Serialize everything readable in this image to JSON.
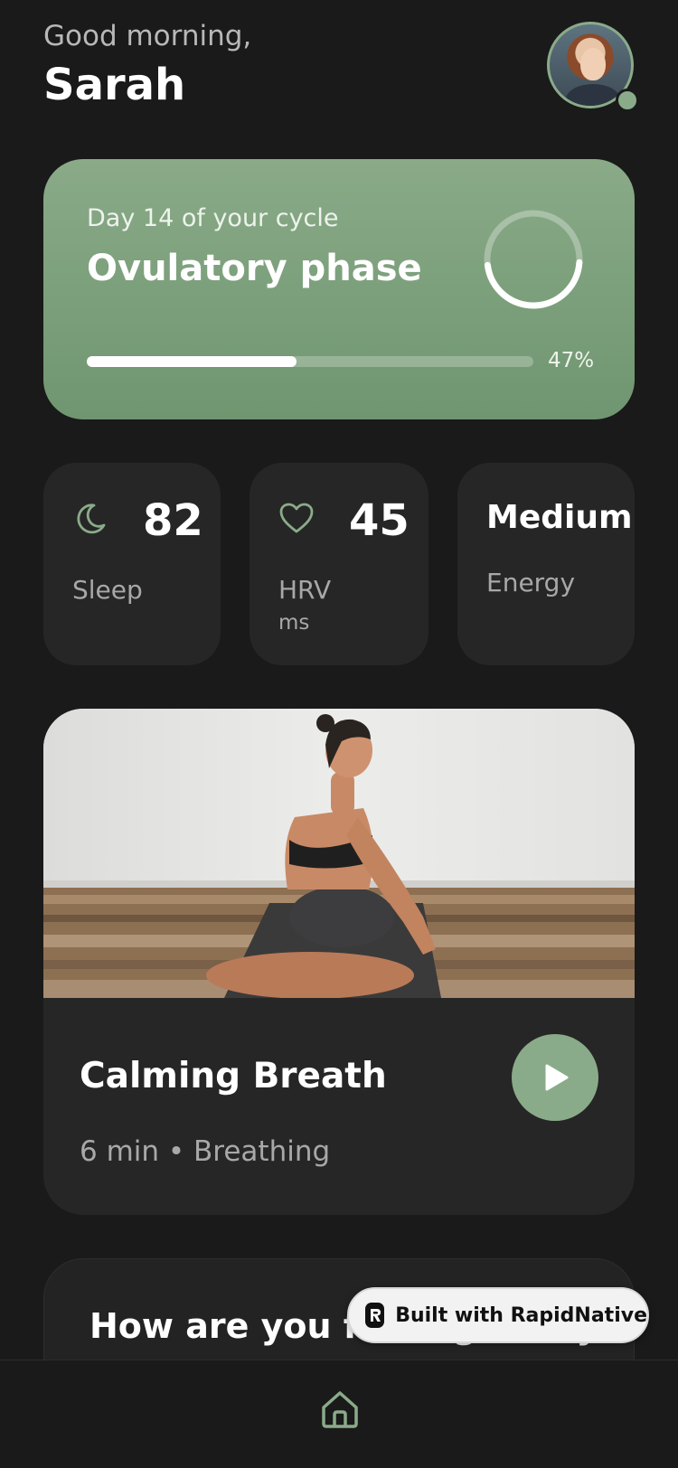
{
  "header": {
    "greeting": "Good morning,",
    "username": "Sarah"
  },
  "cycle": {
    "day_text": "Day 14 of your cycle",
    "phase": "Ovulatory phase",
    "progress_percent": 47,
    "progress_label": "47%"
  },
  "stats": [
    {
      "icon": "moon-icon",
      "value": "82",
      "label": "Sleep",
      "unit": ""
    },
    {
      "icon": "heart-icon",
      "value": "45",
      "label": "HRV",
      "unit": "ms"
    },
    {
      "icon": "",
      "value": "Medium",
      "label": "Energy",
      "unit": ""
    }
  ],
  "session": {
    "title": "Calming Breath",
    "meta": "6 min • Breathing"
  },
  "feeling": {
    "title": "How are you feeling today?"
  },
  "badge": {
    "text": "Built with RapidNative"
  },
  "nav": {
    "items": [
      {
        "icon": "home-icon",
        "active": true
      }
    ]
  },
  "colors": {
    "accent": "#8aab8a",
    "background": "#1a1a1a",
    "card": "#262626"
  }
}
